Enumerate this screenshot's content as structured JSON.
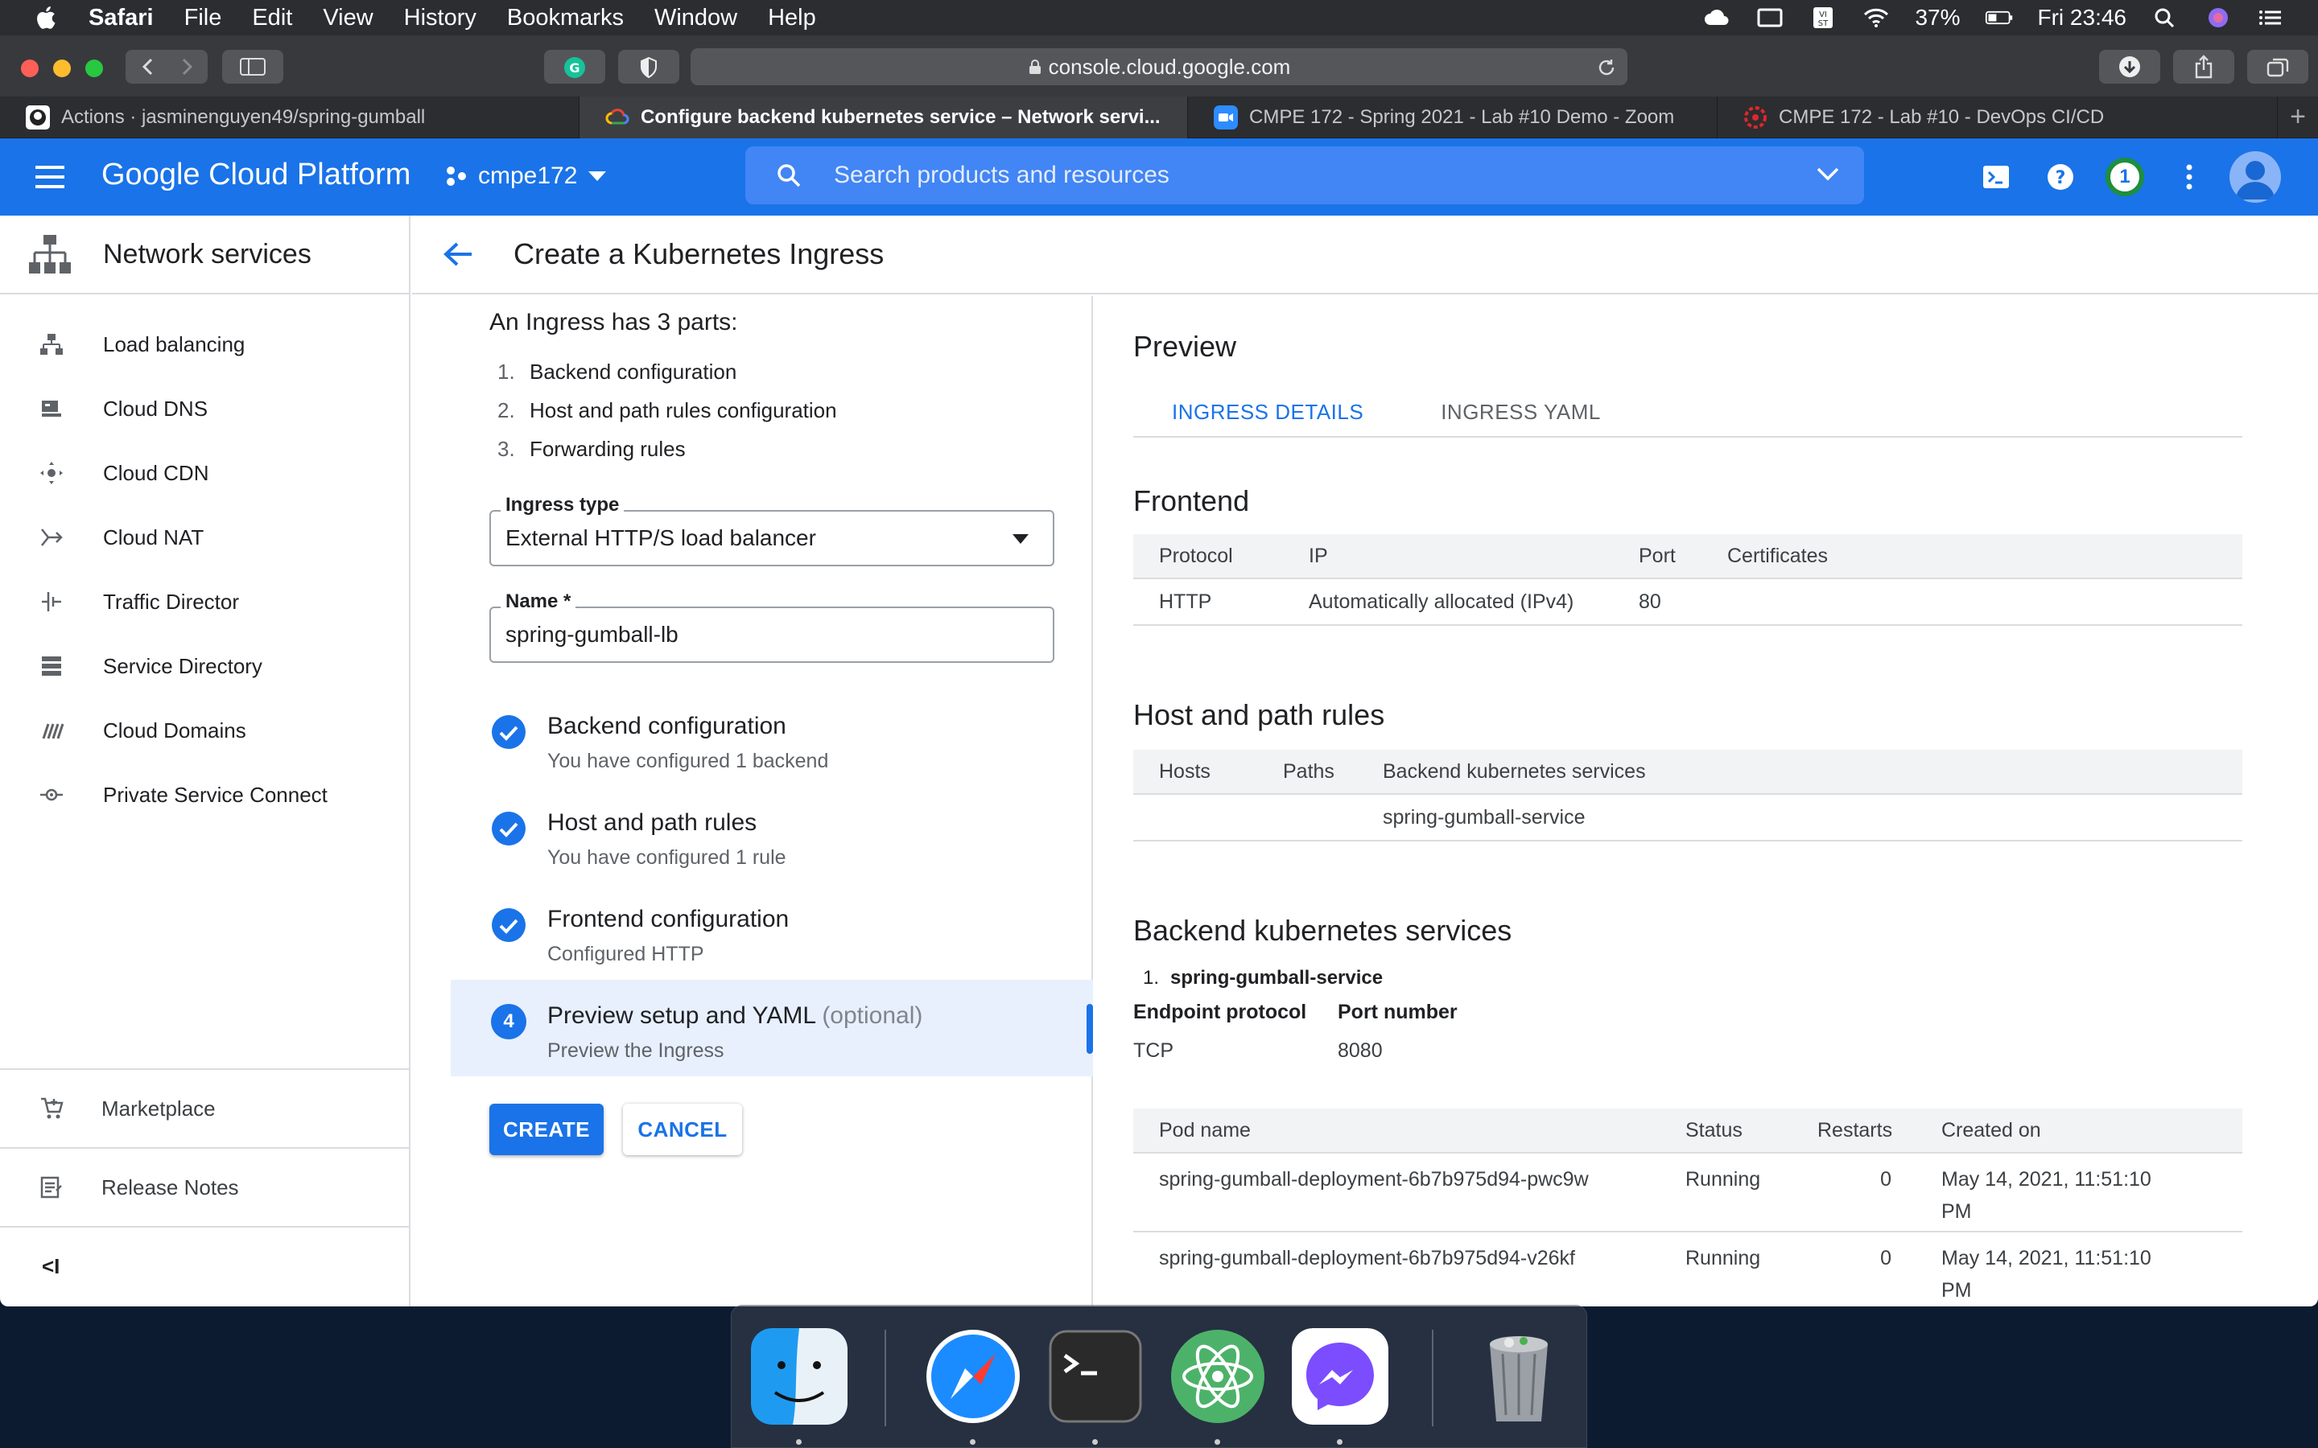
{
  "menubar": {
    "app": "Safari",
    "items": [
      "File",
      "Edit",
      "View",
      "History",
      "Bookmarks",
      "Window",
      "Help"
    ],
    "battery": "37%",
    "clock": "Fri 23:46"
  },
  "browser": {
    "url": "console.cloud.google.com",
    "tabs": [
      {
        "title": "Actions · jasminenguyen49/spring-gumball",
        "icon": "github-icon"
      },
      {
        "title": "Configure backend kubernetes service – Network servi...",
        "icon": "google-cloud-icon"
      },
      {
        "title": "CMPE 172 - Spring 2021 - Lab #10 Demo - Zoom",
        "icon": "zoom-icon"
      },
      {
        "title": "CMPE 172 - Lab #10 - DevOps CI/CD",
        "icon": "sjsu-icon"
      }
    ]
  },
  "gcp": {
    "brand": "Google Cloud Platform",
    "project": "cmpe172",
    "search_placeholder": "Search products and resources",
    "notifications_count": "1"
  },
  "sidebar": {
    "title": "Network services",
    "items": [
      {
        "label": "Load balancing",
        "icon": "load-balancing-icon"
      },
      {
        "label": "Cloud DNS",
        "icon": "cloud-dns-icon"
      },
      {
        "label": "Cloud CDN",
        "icon": "cloud-cdn-icon"
      },
      {
        "label": "Cloud NAT",
        "icon": "cloud-nat-icon"
      },
      {
        "label": "Traffic Director",
        "icon": "traffic-director-icon"
      },
      {
        "label": "Service Directory",
        "icon": "service-directory-icon"
      },
      {
        "label": "Cloud Domains",
        "icon": "cloud-domains-icon"
      },
      {
        "label": "Private Service Connect",
        "icon": "private-service-connect-icon"
      }
    ],
    "marketplace": "Marketplace",
    "release_notes": "Release Notes",
    "collapse": "<I"
  },
  "page": {
    "title": "Create a Kubernetes Ingress"
  },
  "form": {
    "intro": "An Ingress has 3 parts:",
    "parts": [
      "Backend configuration",
      "Host and path rules configuration",
      "Forwarding rules"
    ],
    "ingress_type_label": "Ingress type",
    "ingress_type_value": "External HTTP/S load balancer",
    "name_label": "Name *",
    "name_value": "spring-gumball-lb",
    "steps": [
      {
        "title": "Backend configuration",
        "subtitle": "You have configured 1 backend"
      },
      {
        "title": "Host and path rules",
        "subtitle": "You have configured 1 rule"
      },
      {
        "title": "Frontend configuration",
        "subtitle": "Configured HTTP"
      },
      {
        "title": "Preview setup and YAML",
        "optional": "(optional)",
        "subtitle": "Preview the Ingress",
        "number": "4"
      }
    ],
    "create": "CREATE",
    "cancel": "CANCEL"
  },
  "preview": {
    "title": "Preview",
    "tabs": [
      "INGRESS DETAILS",
      "INGRESS YAML"
    ],
    "frontend": {
      "title": "Frontend",
      "headers": [
        "Protocol",
        "IP",
        "Port",
        "Certificates"
      ],
      "row": [
        "HTTP",
        "Automatically allocated (IPv4)",
        "80",
        ""
      ]
    },
    "rules": {
      "title": "Host and path rules",
      "headers": [
        "Hosts",
        "Paths",
        "Backend kubernetes services"
      ],
      "row": [
        "",
        "",
        "spring-gumball-service"
      ]
    },
    "backend": {
      "title": "Backend kubernetes services",
      "item_number": "1.",
      "item_name": "spring-gumball-service",
      "endpoint_label": "Endpoint protocol",
      "endpoint_value": "TCP",
      "port_label": "Port number",
      "port_value": "8080",
      "pod_headers": [
        "Pod name",
        "Status",
        "Restarts",
        "Created on"
      ],
      "pods": [
        {
          "name": "spring-gumball-deployment-6b7b975d94-pwc9w",
          "status": "Running",
          "restarts": "0",
          "created": "May 14, 2021, 11:51:10 PM"
        },
        {
          "name": "spring-gumball-deployment-6b7b975d94-v26kf",
          "status": "Running",
          "restarts": "0",
          "created": "May 14, 2021, 11:51:10 PM"
        }
      ]
    }
  },
  "dock": [
    "finder-icon",
    "safari-icon",
    "terminal-icon",
    "atom-icon",
    "messenger-icon",
    "trash-icon"
  ],
  "colors": {
    "accent": "#1a73e8",
    "header": "#1a73e8"
  }
}
